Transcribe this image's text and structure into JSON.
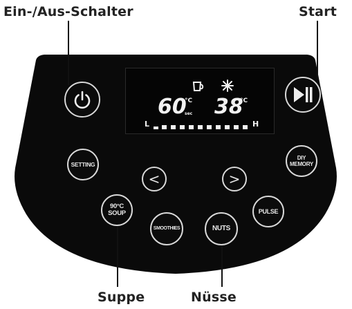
{
  "callouts": {
    "power": "Ein-/Aus-Schalter",
    "start": "Start",
    "soup": "Suppe",
    "nuts": "Nüsse"
  },
  "display": {
    "time_value": "60",
    "time_unit_top": "°C",
    "time_unit_bottom": "sec",
    "temp_value": "38",
    "temp_unit": "°C",
    "speed_low": "L",
    "speed_high": "H",
    "speed_level_bars": 10,
    "icons": [
      "cup-icon",
      "fan-icon"
    ]
  },
  "buttons": {
    "power": {
      "icon": "power-icon"
    },
    "start": {
      "icon": "play-pause-icon"
    },
    "setting": "SETTING",
    "diy_memory": "DIY\nMEMORY",
    "prev": "<",
    "next": ">",
    "soup": "90°C\nSOUP",
    "smoothies": "SMOOTHIES",
    "nuts": "NUTS",
    "pulse": "PULSE"
  },
  "colors": {
    "panel": "#0a0a0a",
    "button_ring": "#d8d8d8",
    "display_text": "#f2f2f2",
    "label_text": "#222222"
  }
}
